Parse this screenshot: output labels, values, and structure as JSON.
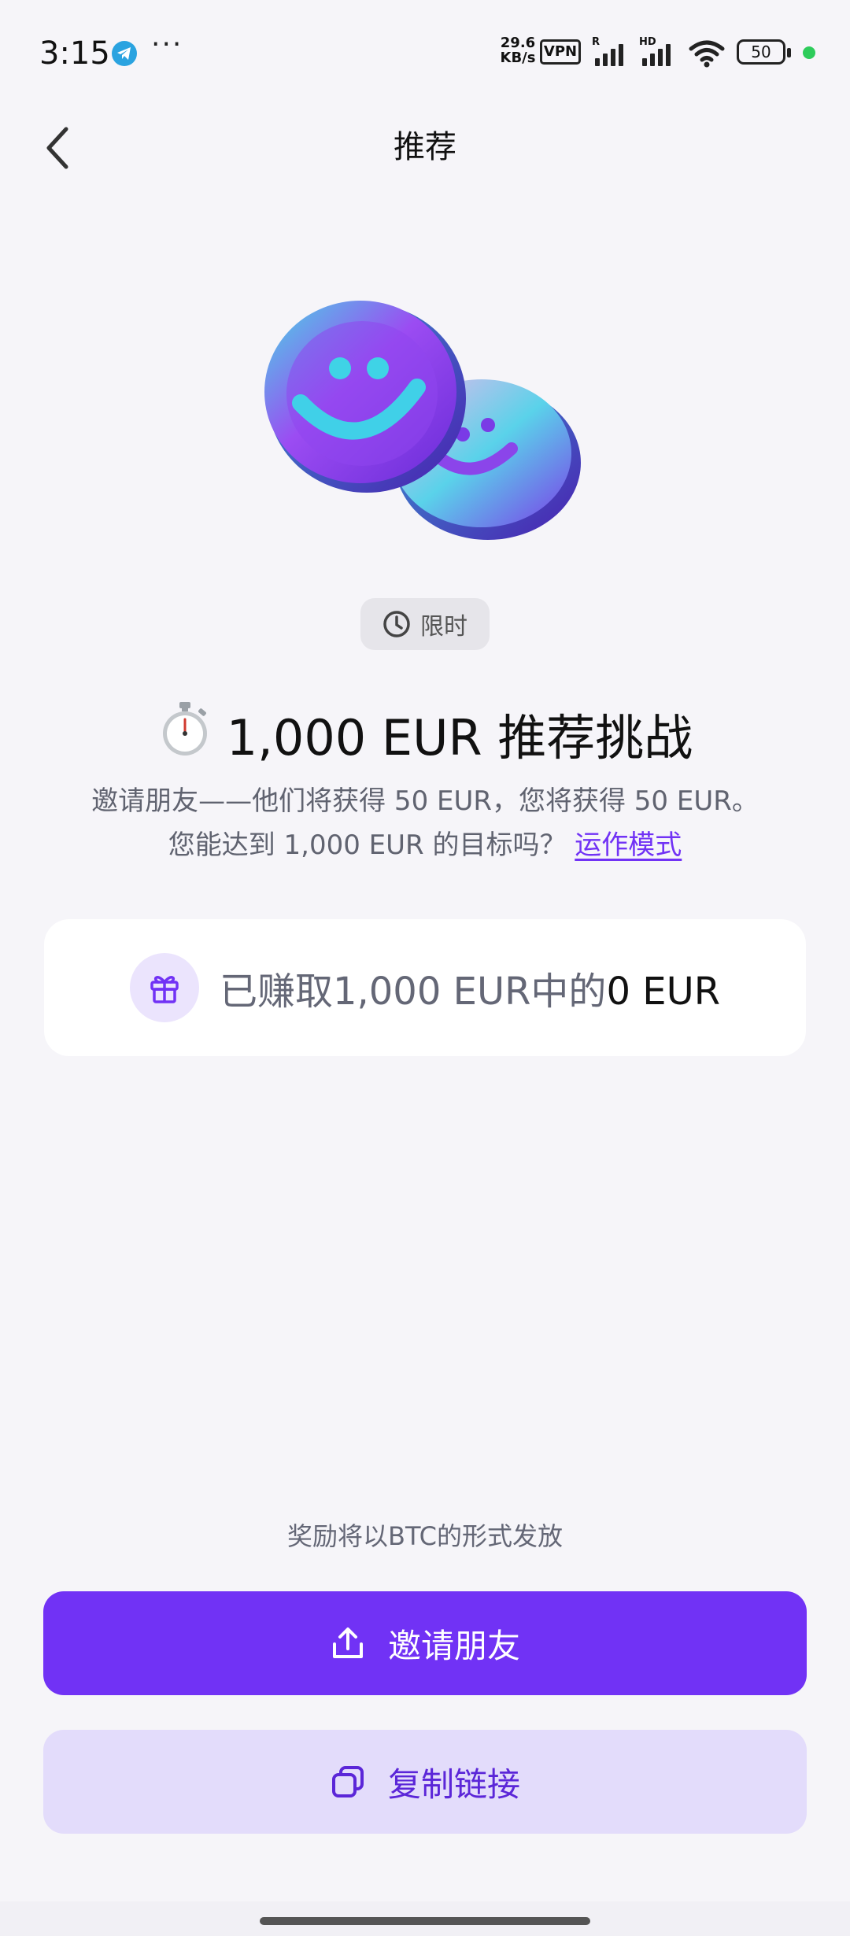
{
  "status_bar": {
    "time": "3:15",
    "net_speed_value": "29.6",
    "net_speed_unit": "KB/s",
    "vpn": "VPN",
    "signal1_tag": "R",
    "signal2_tag": "HD",
    "battery": "50",
    "icons": [
      "telegram-icon",
      "more-dots-icon",
      "wifi-icon",
      "battery-icon"
    ]
  },
  "header": {
    "title": "推荐"
  },
  "badge": {
    "label": "限时"
  },
  "challenge": {
    "title": "1,000 EUR 推荐挑战",
    "description_line1": "邀请朋友——他们将获得 50 EUR，您将获得 50 EUR。",
    "description_line2": "您能达到 1,000 EUR 的目标吗？",
    "how_it_works_link": "运作模式"
  },
  "earned": {
    "prefix": "已赚取1,000 EUR中的",
    "amount": "0 EUR"
  },
  "footer": {
    "reward_note": "奖励将以BTC的形式发放",
    "invite_button": "邀请朋友",
    "copy_button": "复制链接"
  },
  "colors": {
    "accent": "#7132f5",
    "secondary_button_bg": "#e3dcfb",
    "background": "#f6f5f9"
  }
}
